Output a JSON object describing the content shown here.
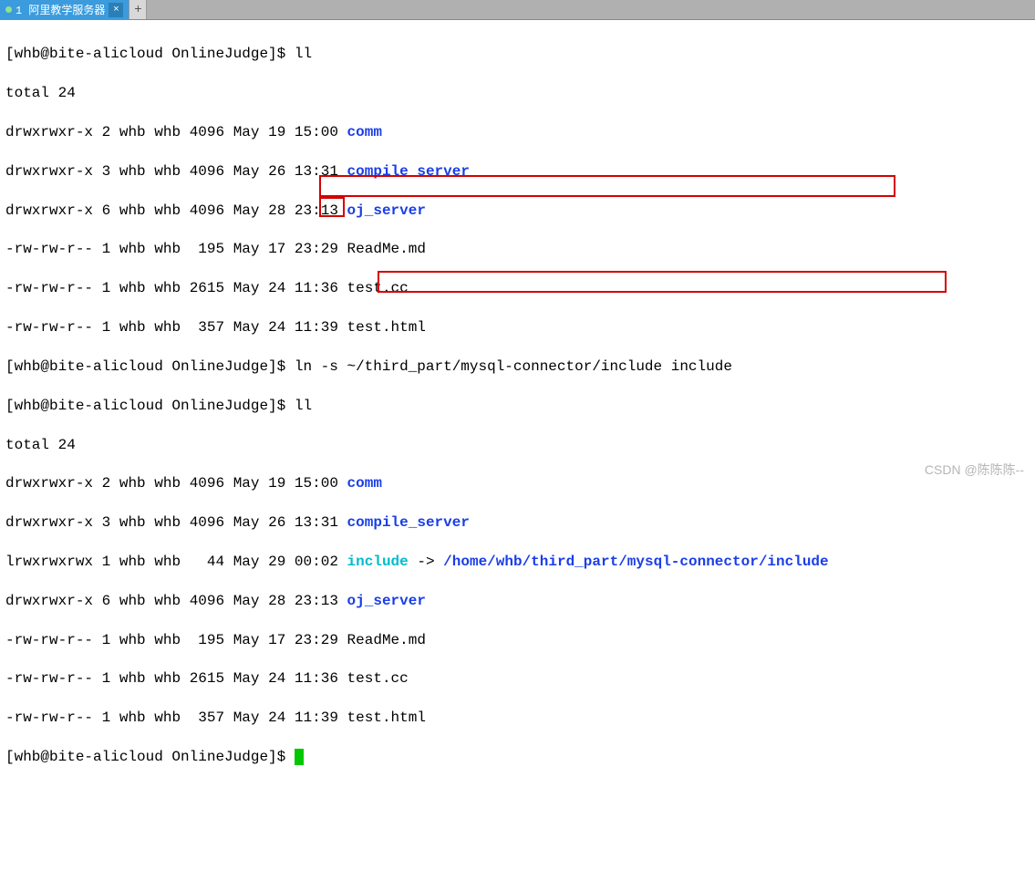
{
  "tab": {
    "title": "1 阿里教学服务器"
  },
  "prompt": {
    "user": "whb",
    "host": "bite-alicloud",
    "dir": "OnlineJudge",
    "prefix": "[whb@bite-alicloud OnlineJudge]$ "
  },
  "cmd": {
    "ll1": "ll",
    "ln": "ln -s ~/third_part/mysql-connector/include include",
    "ll2": "ll"
  },
  "total": {
    "label1": "total 24",
    "label2": "total 24"
  },
  "listing1": [
    {
      "perm": "drwxrwxr-x",
      "links": "2",
      "owner": "whb",
      "group": "whb",
      "size": "4096",
      "date": "May 19 15:00",
      "name": "comm",
      "type": "dir"
    },
    {
      "perm": "drwxrwxr-x",
      "links": "3",
      "owner": "whb",
      "group": "whb",
      "size": "4096",
      "date": "May 26 13:31",
      "name": "compile_server",
      "type": "dir"
    },
    {
      "perm": "drwxrwxr-x",
      "links": "6",
      "owner": "whb",
      "group": "whb",
      "size": "4096",
      "date": "May 28 23:13",
      "name": "oj_server",
      "type": "dir"
    },
    {
      "perm": "-rw-rw-r--",
      "links": "1",
      "owner": "whb",
      "group": "whb",
      "size": " 195",
      "date": "May 17 23:29",
      "name": "ReadMe.md",
      "type": "file"
    },
    {
      "perm": "-rw-rw-r--",
      "links": "1",
      "owner": "whb",
      "group": "whb",
      "size": "2615",
      "date": "May 24 11:36",
      "name": "test.cc",
      "type": "file"
    },
    {
      "perm": "-rw-rw-r--",
      "links": "1",
      "owner": "whb",
      "group": "whb",
      "size": " 357",
      "date": "May 24 11:39",
      "name": "test.html",
      "type": "file"
    }
  ],
  "listing2": [
    {
      "perm": "drwxrwxr-x",
      "links": "2",
      "owner": "whb",
      "group": "whb",
      "size": "4096",
      "date": "May 19 15:00",
      "name": "comm",
      "type": "dir"
    },
    {
      "perm": "drwxrwxr-x",
      "links": "3",
      "owner": "whb",
      "group": "whb",
      "size": "4096",
      "date": "May 26 13:31",
      "name": "compile_server",
      "type": "dir"
    },
    {
      "perm": "lrwxrwxrwx",
      "links": "1",
      "owner": "whb",
      "group": "whb",
      "size": "  44",
      "date": "May 29 00:02",
      "name": "include",
      "arrow": " -> ",
      "target": "/home/whb/third_part/mysql-connector/include",
      "type": "link"
    },
    {
      "perm": "drwxrwxr-x",
      "links": "6",
      "owner": "whb",
      "group": "whb",
      "size": "4096",
      "date": "May 28 23:13",
      "name": "oj_server",
      "type": "dir"
    },
    {
      "perm": "-rw-rw-r--",
      "links": "1",
      "owner": "whb",
      "group": "whb",
      "size": " 195",
      "date": "May 17 23:29",
      "name": "ReadMe.md",
      "type": "file"
    },
    {
      "perm": "-rw-rw-r--",
      "links": "1",
      "owner": "whb",
      "group": "whb",
      "size": "2615",
      "date": "May 24 11:36",
      "name": "test.cc",
      "type": "file"
    },
    {
      "perm": "-rw-rw-r--",
      "links": "1",
      "owner": "whb",
      "group": "whb",
      "size": " 357",
      "date": "May 24 11:39",
      "name": "test.html",
      "type": "file"
    }
  ],
  "watermark": "CSDN @陈陈陈--"
}
